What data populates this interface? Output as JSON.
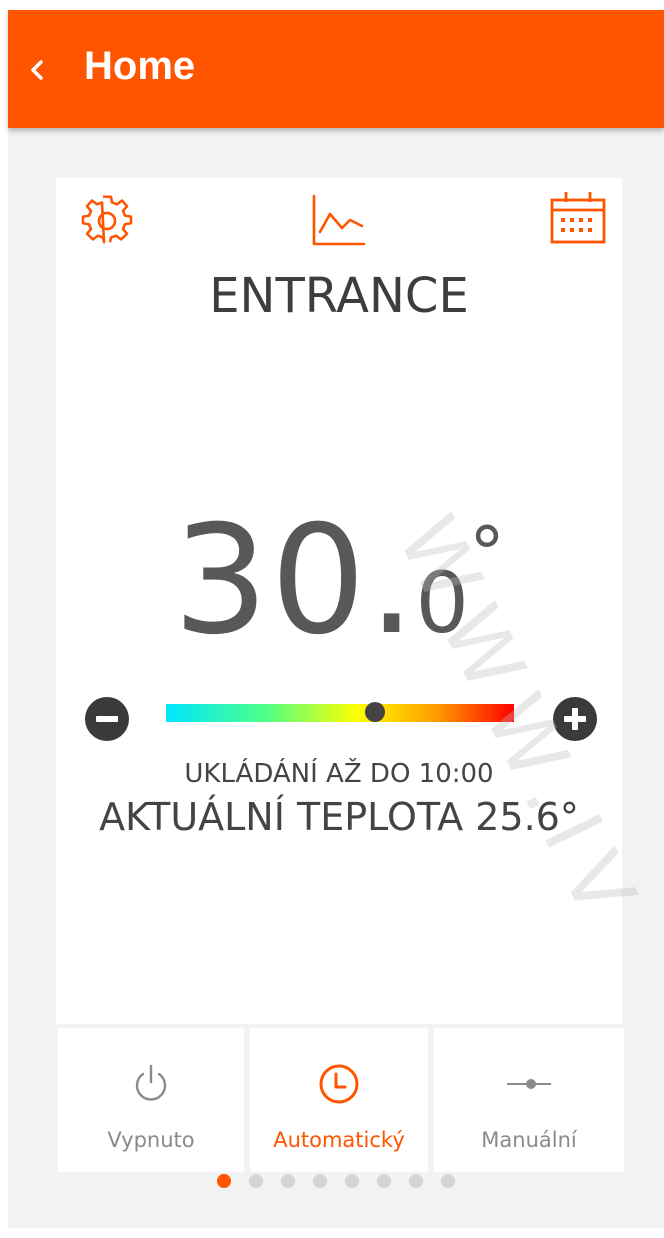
{
  "header": {
    "title": "Home",
    "back_icon": "chevron-left-icon",
    "color": "#ff5400"
  },
  "toolbar": {
    "settings_icon": "gear-icon",
    "chart_icon": "line-chart-icon",
    "calendar_icon": "calendar-icon"
  },
  "zone": {
    "name": "ENTRANCE"
  },
  "setpoint": {
    "integer": "30",
    "decimal_point": ".",
    "decimal": "0",
    "degree": "°",
    "slider_fraction": 0.6
  },
  "status": {
    "hold_text": "UKLÁDÁNÍ AŽ DO 10:00",
    "current_temp": "AKTUÁLNÍ TEPLOTA 25.6°"
  },
  "modes": [
    {
      "label": "Vypnuto",
      "icon": "power-icon",
      "active": false
    },
    {
      "label": "Automatický",
      "icon": "clock-icon",
      "active": true
    },
    {
      "label": "Manuální",
      "icon": "slider-icon",
      "active": false
    }
  ],
  "pager": {
    "count": 8,
    "active_index": 0
  },
  "colors": {
    "accent": "#ff5400",
    "inactive_text": "#8a8a8a",
    "text": "#444444"
  },
  "watermark": "WWW.IV"
}
